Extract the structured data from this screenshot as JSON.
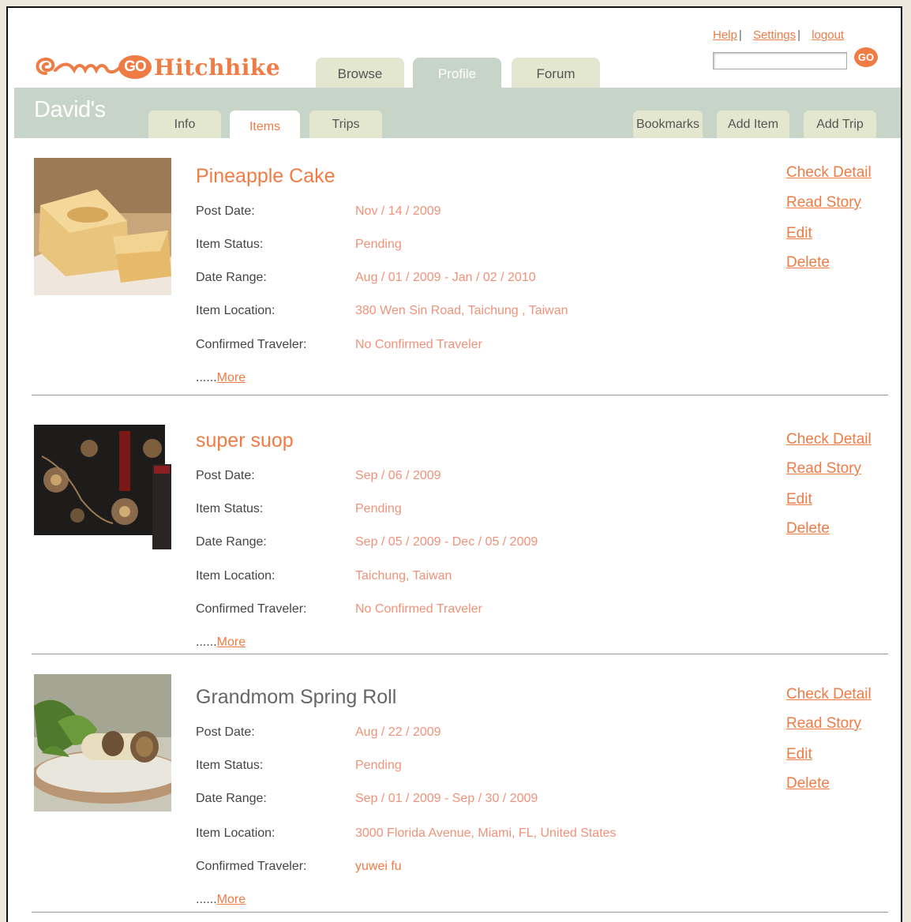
{
  "header": {
    "brand": "Hitchhike",
    "brand_badge": "GO",
    "main_tabs": [
      "Browse",
      "Profile",
      "Forum"
    ],
    "active_main_tab": "Profile",
    "links": {
      "help": "Help",
      "settings": "Settings",
      "logout": "logout",
      "separator": "|"
    },
    "search": {
      "value": "",
      "placeholder": "",
      "go_label": "GO"
    }
  },
  "profile_bar": {
    "user": "David's",
    "tabs": [
      "Info",
      "Items",
      "Trips"
    ],
    "active_tab": "Items",
    "actions": [
      "Bookmarks",
      "Add Item",
      "Add Trip"
    ]
  },
  "field_labels": {
    "post_date": "Post Date:",
    "status": "Item Status:",
    "date_range": "Date Range:",
    "location": "Item Location:",
    "traveler": "Confirmed Traveler:"
  },
  "more": {
    "prefix": "......",
    "link": "More"
  },
  "item_actions": [
    "Check Detail",
    "Read Story",
    "Edit",
    "Delete"
  ],
  "items": [
    {
      "title": "Pineapple Cake",
      "image": "pineapple-cake-photo",
      "post_date": "Nov / 14 / 2009",
      "status": "Pending",
      "date_range": "Aug / 01 / 2009 - Jan / 02 / 2010",
      "location": "380 Wen Sin Road, Taichung , Taiwan",
      "traveler": "No Confirmed Traveler"
    },
    {
      "title": "super suop",
      "image": "soup-box-photo",
      "post_date": "Sep / 06 / 2009",
      "status": "Pending",
      "date_range": "Sep / 05 / 2009 - Dec / 05 / 2009",
      "location": "Taichung, Taiwan",
      "traveler": "No Confirmed Traveler"
    },
    {
      "title": "Grandmom Spring Roll",
      "image": "spring-roll-photo",
      "post_date": "Aug / 22 / 2009",
      "status": "Pending",
      "date_range": "Sep / 01 / 2009 - Sep / 30 / 2009",
      "location": "3000 Florida Avenue, Miami, FL, United States",
      "traveler": "yuwei fu"
    }
  ],
  "colors": {
    "accent": "#ef7b45",
    "value_text": "#f0927a",
    "green_bar": "#c7d5c8",
    "tab_inactive": "#e4e7cf",
    "page_bg": "#ece6dc"
  }
}
